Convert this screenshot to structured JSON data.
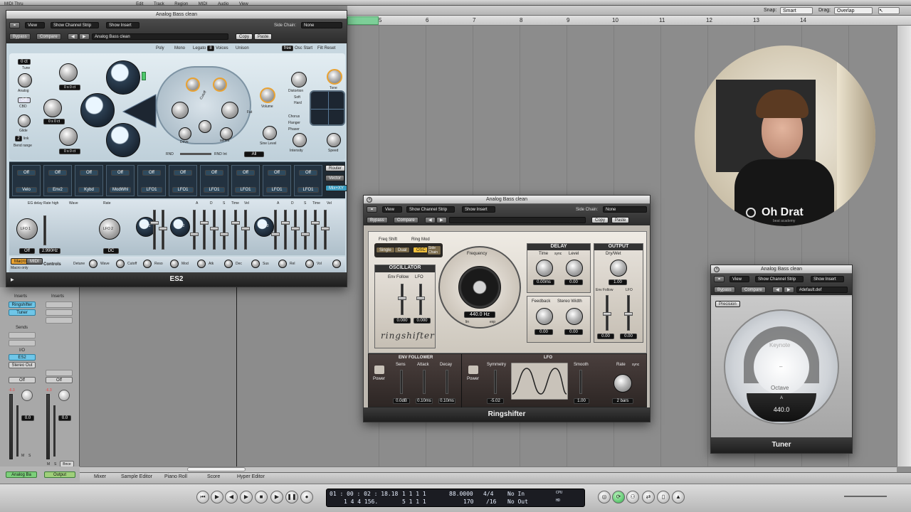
{
  "menubar": {
    "items": [
      "MIDI Thru",
      "Edit",
      "Track",
      "Region",
      "MIDI",
      "Audio",
      "View"
    ]
  },
  "arrange": {
    "snap_label": "Snap:",
    "snap_value": "Smart",
    "drag_label": "Drag:",
    "drag_value": "Overlap",
    "ruler_numbers": [
      "5",
      "6",
      "7",
      "8",
      "9",
      "10",
      "11",
      "12",
      "13",
      "14"
    ]
  },
  "es2": {
    "title": "Analog Bass clean",
    "view": "View",
    "show_channel_strip": "Show Channel Strip",
    "show_insert": "Show Insert",
    "side_chain_label": "Side Chain:",
    "side_chain_value": "None",
    "bypass": "Bypass",
    "compare": "Compare",
    "preset": "Analog Bass clean",
    "copy": "Copy",
    "paste": "Paste",
    "voice_modes": [
      "Poly",
      "Mono",
      "Legato",
      "Voices",
      "Unison"
    ],
    "voices_value": "8",
    "osc_start": "free",
    "osc_start_label": "Osc Start",
    "filt_reset": "Filt Reset",
    "osc_values": [
      "0 ct",
      "0 s",
      "0 s"
    ],
    "osc_tuning": [
      "0 s 0 ct",
      "0 s 0 ct",
      "0 s 0 ct"
    ],
    "left_buttons": [
      "Off",
      "Off",
      "2"
    ],
    "left_labels": [
      "Tune",
      "Analog",
      "CBD",
      "Glide",
      "Bend range",
      "link"
    ],
    "filter_labels": [
      "Cutoff",
      "Resonance",
      "Drive",
      "Filter Blend",
      "series",
      "Fat"
    ],
    "output_labels": [
      "Volume",
      "Sine Level",
      "Distortion",
      "Soft",
      "Hard",
      "Intensity",
      "Speed",
      "Tone"
    ],
    "effect_modes": [
      "Chorus",
      "Flanger",
      "Phaser"
    ],
    "rnd_label": "RND",
    "rnd_int": "RND Int",
    "all_button": "All",
    "router_tabs": [
      "Router",
      "Vector",
      "Mix+XY"
    ],
    "router_cells": [
      "Off",
      "Off",
      "Off",
      "Off",
      "Off",
      "Off",
      "Off",
      "Off",
      "Off",
      "Off"
    ],
    "router_sources": [
      "Velo",
      "Env2",
      "Kybd",
      "ModWhl",
      "LFO1",
      "LFO1",
      "LFO1",
      "LFO1",
      "LFO1",
      "LFO1"
    ],
    "lfo_labels": [
      "EG delay",
      "Rate high",
      "Wave",
      "Rate",
      "LFO 1",
      "LFO 2"
    ],
    "lfo_values": [
      "Off",
      "2.990Hz",
      "DC"
    ],
    "env_labels": [
      "ENV 1",
      "ENV 2",
      "ENV 3"
    ],
    "env_sliders": [
      "A",
      "D",
      "S",
      "R",
      "Time",
      "Vel"
    ],
    "macro_tabs": [
      "Macro",
      "MIDI",
      "Macro only"
    ],
    "controls_label": "Controls",
    "macro_knobs": [
      "Detune",
      "Wave",
      "Cutoff",
      "Reso",
      "Mod",
      "Atk",
      "Dec",
      "Sus",
      "Rel",
      "Vol"
    ],
    "footer": "ES2"
  },
  "ringshifter": {
    "title": "Analog Bass clean",
    "view": "View",
    "show_channel_strip": "Show Channel Strip",
    "show_insert": "Show Insert",
    "side_chain_label": "Side Chain:",
    "side_chain_value": "None",
    "bypass": "Bypass",
    "compare": "Compare",
    "preset": "",
    "copy": "Copy",
    "paste": "Paste",
    "freq_shift": "Freq Shift",
    "ring_mod": "Ring Mod",
    "mode_buttons": [
      "Single",
      "Dual",
      "OSC",
      "Side Chain"
    ],
    "oscillator": "OSCILLATOR",
    "env_follow": "Env Follow",
    "lfo": "LFO",
    "osc_vals": [
      "0.000",
      "0.000"
    ],
    "frequency": "Frequency",
    "freq_value": "440.0 Hz",
    "lin": "lin",
    "exp": "exp",
    "logo": "ringshifter",
    "delay": "DELAY",
    "time": "Time",
    "sync": "sync",
    "level": "Level",
    "delay_vals": [
      "0.00ms",
      "0.00"
    ],
    "output": "OUTPUT",
    "dry_wet": "Dry/Wet",
    "dry_wet_val": "1.00",
    "feedback": "Feedback",
    "stereo_width": "Stereo Width",
    "fb_vals": [
      "0.00",
      "0.00"
    ],
    "env_follow_out": "Env Follow",
    "lfo_out": "LFO",
    "out_vals": [
      "0.00",
      "0.00"
    ],
    "env_follower": "ENV FOLLOWER",
    "power": "Power",
    "sens": "Sens",
    "attack": "Attack",
    "decay": "Decay",
    "ef_vals": [
      "0.0dB",
      "0.10ms",
      "0.10ms"
    ],
    "lfo_section": "LFO",
    "symmetry": "Symmetry",
    "symmetry_val": "-5.02",
    "smooth": "Smooth",
    "smooth_val": "1.00",
    "rate": "Rate",
    "rate_sync": "sync",
    "rate_val": "2 bars",
    "footer": "Ringshifter"
  },
  "tuner": {
    "title": "Analog Bass clean",
    "view": "View",
    "show_channel_strip": "Show Channel Strip",
    "show_insert": "Show Insert",
    "bypass": "Bypass",
    "compare": "Compare",
    "preset": "#default.def",
    "precision": "Precision",
    "keynote": "Keynote",
    "octave": "Octave",
    "a_label": "A",
    "ref_freq": "440.0",
    "footer": "Tuner"
  },
  "webcam": {
    "logo_text": "Oh Drat",
    "logo_sub": "beat academy"
  },
  "channel_strips": {
    "inserts": "Inserts",
    "insert_slots": [
      "Ringshifter",
      "Tuner"
    ],
    "sends": "Sends",
    "io": "I/O",
    "io_slots": [
      "ES2",
      "Stereo Out"
    ],
    "off_buttons": [
      "Off",
      "Off"
    ],
    "pan_vals": [
      "0.0",
      "0.0"
    ],
    "meter_vals": [
      "-6.3",
      "-6.3"
    ],
    "mute_solo": [
      "M",
      "S",
      "M",
      "S"
    ],
    "bnce": "Bnce",
    "names": [
      "Analog Ba",
      "Output"
    ]
  },
  "bottom_tabs": [
    "Mixer",
    "Sample Editor",
    "Piano Roll",
    "Score",
    "Hyper Editor"
  ],
  "transport": {
    "smpte": "01 : 00 : 02 : 18.18",
    "smpte2": "1   4   4  156.",
    "bar_pos": "1   1   1   1",
    "bar_pos2": "5   1   1   1",
    "tempo": "88.0000",
    "tempo2": "170",
    "sig": "4/4",
    "sig2": "/16",
    "in": "No In",
    "out": "No Out",
    "cpu": "CPU",
    "hd": "HD"
  }
}
